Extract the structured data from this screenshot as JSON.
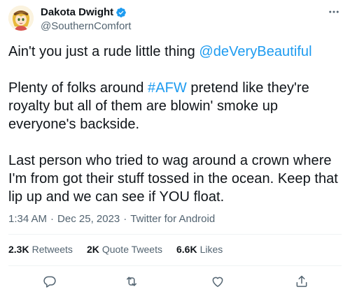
{
  "author": {
    "display_name": "Dakota Dwight",
    "handle": "@SouthernComfort",
    "verified": true,
    "verified_color": "#1d9bf0",
    "avatar_icon": "anime-character-avatar"
  },
  "tweet": {
    "line1_text": "Ain't you just a rude little thing ",
    "line1_mention": "@deVeryBeautiful",
    "para2_prefix": "Plenty of folks around ",
    "para2_hashtag": "#AFW",
    "para2_suffix": " pretend like they're royalty but all of them are blowin' smoke up everyone's backside.",
    "para3": "Last person who tried to wag around a crown where I'm from got their stuff tossed in the ocean. Keep that lip up and we can see if YOU float.",
    "link_color": "#1d9bf0"
  },
  "meta": {
    "time": "1:34 AM",
    "separator": "·",
    "date": "Dec 25, 2023",
    "source": "Twitter for Android"
  },
  "stats": {
    "retweets_count": "2.3K",
    "retweets_label": "Retweets",
    "quotes_count": "2K",
    "quotes_label": "Quote Tweets",
    "likes_count": "6.6K",
    "likes_label": "Likes"
  },
  "actions": {
    "icons": [
      "reply-icon",
      "retweet-icon",
      "like-icon",
      "share-icon"
    ],
    "icon_color": "#536471"
  }
}
